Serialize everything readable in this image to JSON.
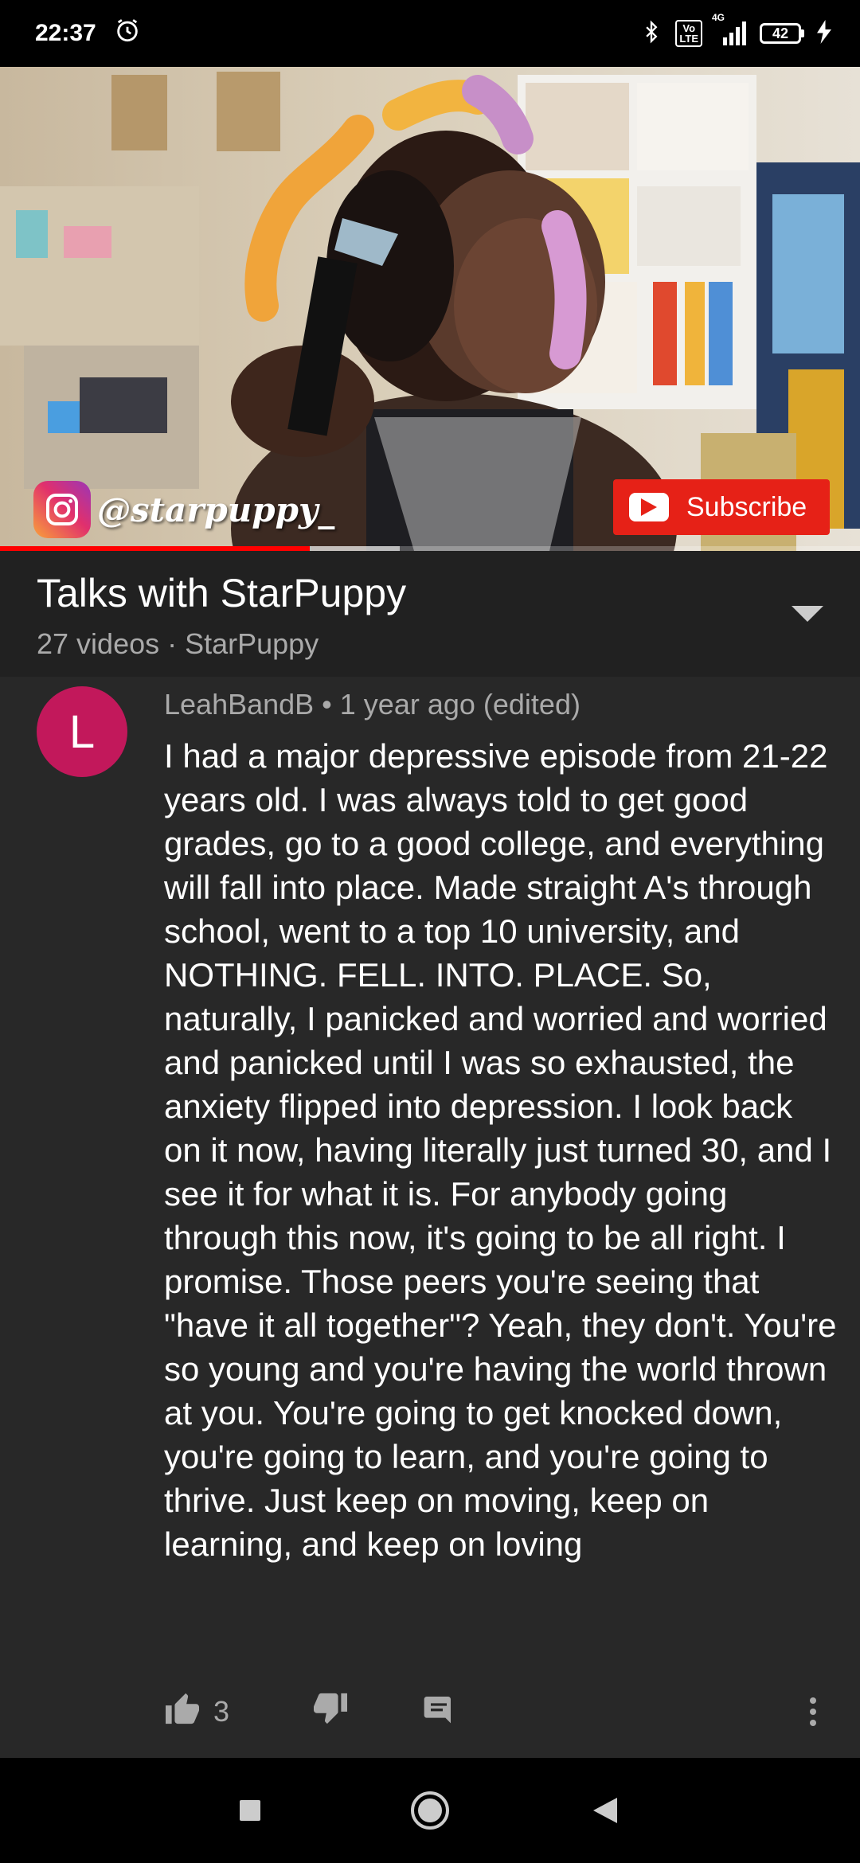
{
  "status_bar": {
    "time": "22:37",
    "network_badge_top": "Vo",
    "network_badge_bottom": "LTE",
    "network_type": "4G",
    "battery": "42",
    "icons": [
      "alarm-icon",
      "bluetooth-icon",
      "volte-icon",
      "signal-icon",
      "battery-icon",
      "charging-icon"
    ]
  },
  "video": {
    "watermark_handle": "@starpuppy_",
    "subscribe_label": "Subscribe",
    "progress_fraction": 0.36,
    "buffer_fraction": 0.465
  },
  "playlist": {
    "title": "Talks with StarPuppy",
    "meta": "27 videos · StarPuppy"
  },
  "comment": {
    "avatar_letter": "L",
    "avatar_color": "#c2185b",
    "header": "LeahBandB • 1 year ago (edited)",
    "body": "I had a major depressive episode from 21-22 years old. I was always told to get good grades, go to a good college, and everything will fall into place. Made straight A's through school, went to a top 10 university, and NOTHING. FELL. INTO. PLACE. So, naturally, I panicked and worried and worried and panicked until I was so exhausted, the anxiety flipped into depression. I look back on it now, having literally just turned 30, and I see it for what it is. For anybody going through this now, it's going to be all right. I promise. Those peers you're seeing that \"have it all together\"? Yeah, they don't. You're so young and you're having the world thrown at you. You're going to get knocked down, you're going to learn, and you're going to thrive. Just keep on moving, keep on learning, and keep on loving",
    "like_count": "3"
  },
  "colors": {
    "accent_red": "#ff0000",
    "subscribe_red": "#e62117",
    "panel": "#212121",
    "comment_bg": "#282828"
  }
}
